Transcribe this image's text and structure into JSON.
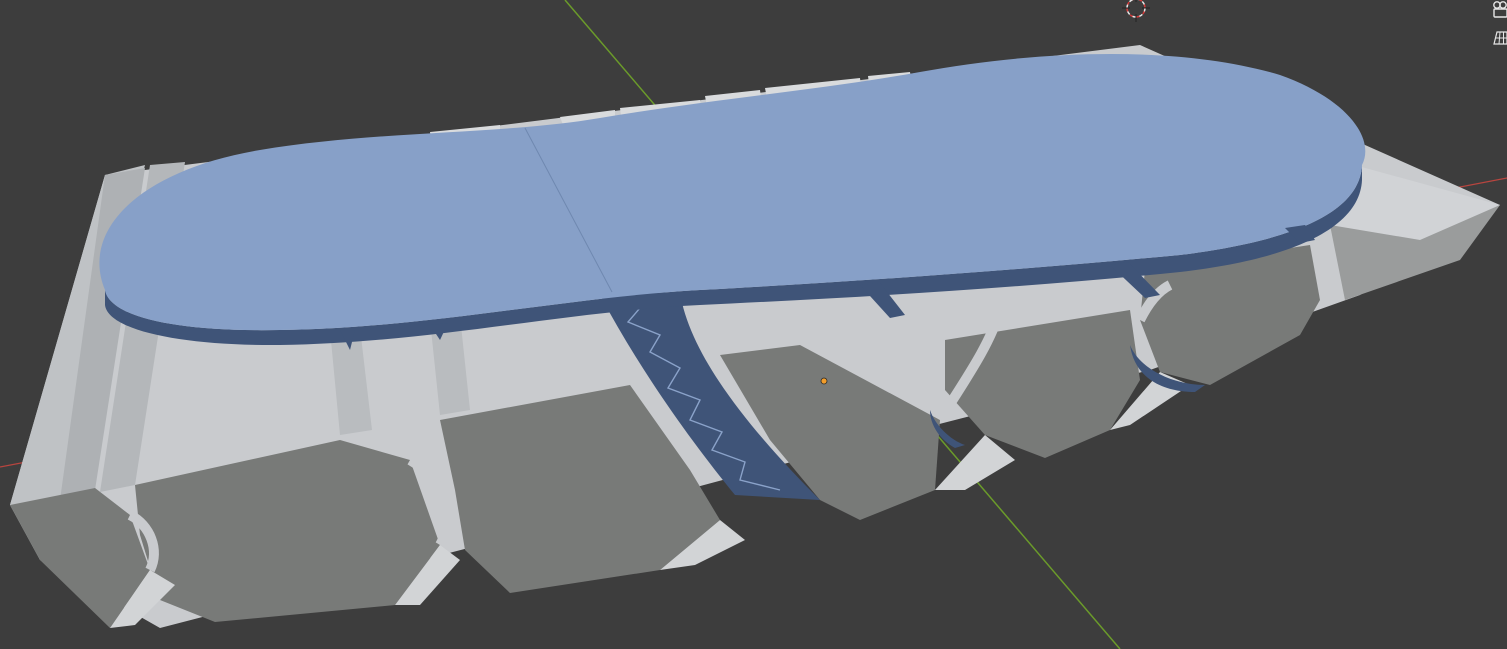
{
  "app": "Blender",
  "view": {
    "type": "3D Viewport",
    "colors": {
      "background": "#3d3d3d",
      "grid_floor": "#3a3a3a",
      "axis_x": "#c24a4a",
      "axis_y": "#6b9b2a",
      "selected_face": "#8aa2c9",
      "selected_edge_dark": "#3f5478",
      "mesh_top": "#c7c9cc",
      "mesh_side": "#7a7c7a",
      "cursor_ring": "#e8e8e8",
      "cursor_red": "#d63a3a",
      "origin": "#f29d2a"
    }
  },
  "gizmos": {
    "camera_icon": "camera-icon",
    "ortho_icon": "grid-perspective-icon"
  }
}
